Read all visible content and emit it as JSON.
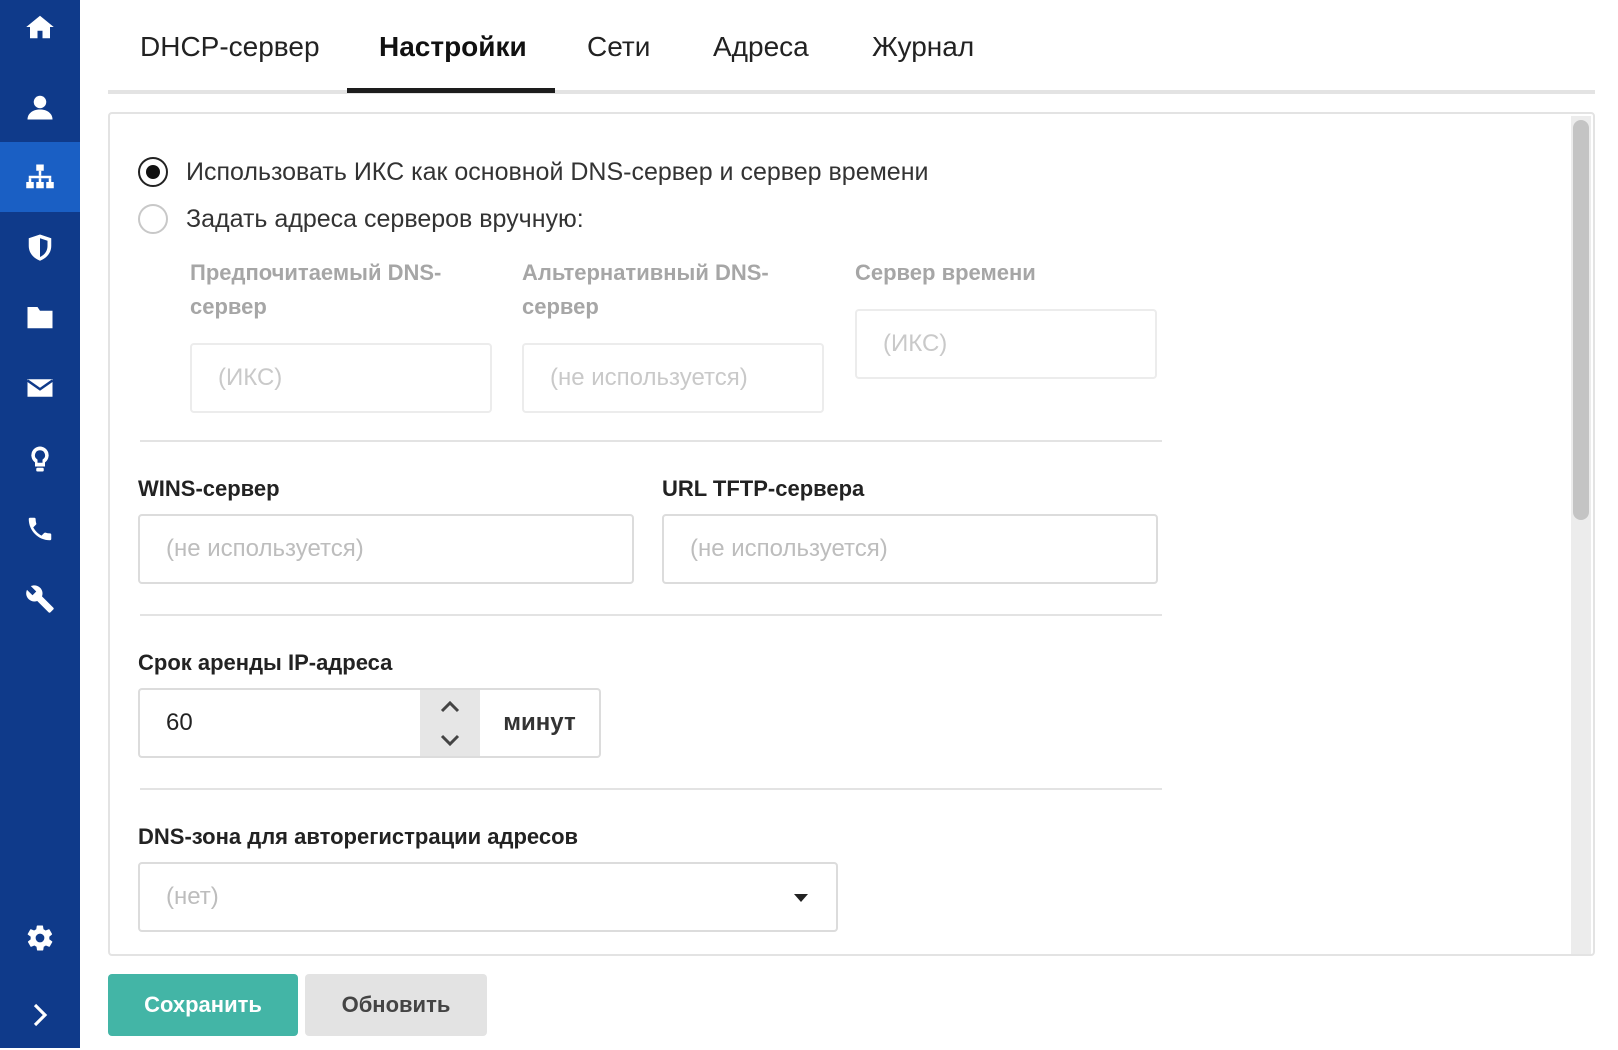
{
  "sidebar": {
    "items": [
      {
        "icon": "home-icon"
      },
      {
        "icon": "user-icon"
      },
      {
        "icon": "network-icon",
        "active": true
      },
      {
        "icon": "shield-icon"
      },
      {
        "icon": "folder-icon"
      },
      {
        "icon": "mail-icon"
      },
      {
        "icon": "lightbulb-icon"
      },
      {
        "icon": "phone-icon"
      },
      {
        "icon": "wrench-icon"
      },
      {
        "icon": "gear-icon"
      },
      {
        "icon": "chevron-right-icon"
      }
    ],
    "accent_color": "#0f3a8a",
    "active_color": "#1a5fc4"
  },
  "tabs": [
    {
      "label": "DHCP-сервер"
    },
    {
      "label": "Настройки",
      "active": true
    },
    {
      "label": "Сети"
    },
    {
      "label": "Адреса"
    },
    {
      "label": "Журнал"
    }
  ],
  "dns": {
    "option_use_ics": "Использовать ИКС как основной DNS-сервер и сервер времени",
    "option_manual": "Задать адреса серверов вручную:",
    "selected": "use_ics",
    "preferred_label_1": "Предпочитаемый DNS-",
    "preferred_label_2": "сервер",
    "preferred_placeholder": "(ИКС)",
    "alternative_label_1": "Альтернативный DNS-",
    "alternative_label_2": "сервер",
    "alternative_placeholder": "(не используется)",
    "time_label": "Сервер времени",
    "time_placeholder": "(ИКС)"
  },
  "wins": {
    "label": "WINS-сервер",
    "placeholder": "(не используется)"
  },
  "tftp": {
    "label": "URL TFTP-сервера",
    "placeholder": "(не используется)"
  },
  "lease": {
    "label": "Срок аренды IP-адреса",
    "value": "60",
    "unit": "минут"
  },
  "dns_zone": {
    "label": "DNS-зона для авторегистрации адресов",
    "selected": "(нет)"
  },
  "buttons": {
    "save": "Сохранить",
    "refresh": "Обновить",
    "save_color": "#43b5a6"
  }
}
